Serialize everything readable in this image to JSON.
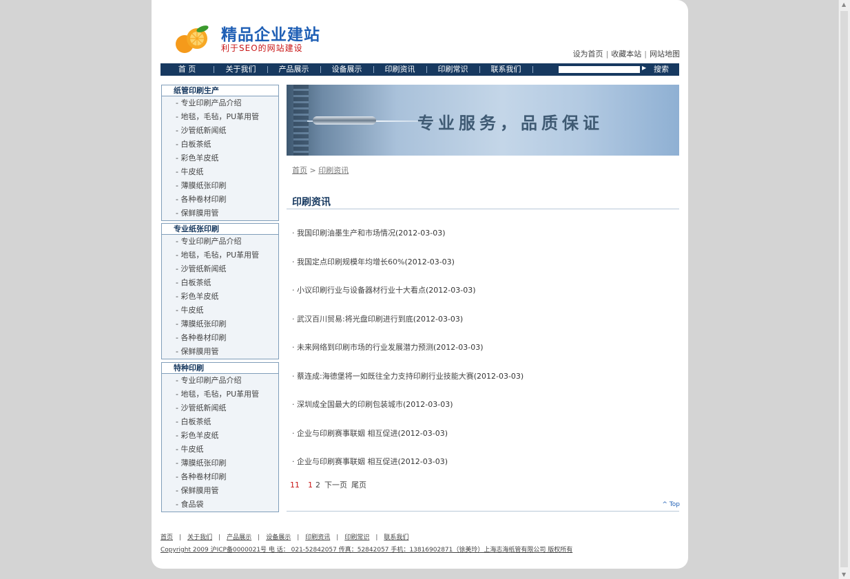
{
  "header": {
    "logo_name": "精品企业建站",
    "logo_slogan": "利于SEO的网站建设",
    "top_links": [
      "设为首页",
      "收藏本站",
      "网站地图"
    ]
  },
  "nav": {
    "items": [
      "首 页",
      "关于我们",
      "产品展示",
      "设备展示",
      "印刷资讯",
      "印刷常识",
      "联系我们"
    ],
    "search_button": "搜索",
    "search_value": ""
  },
  "sidebar": [
    {
      "title": "纸管印刷生产",
      "items": [
        "- 专业印刷产品介绍",
        "- 地毯，毛毡，PU革用管",
        "- 沙管纸新闻纸",
        "- 白板茶纸",
        "- 彩色羊皮纸",
        "- 牛皮纸",
        "- 薄膜纸张印刷",
        "- 各种卷材印刷",
        "- 保鲜膜用管"
      ]
    },
    {
      "title": "专业纸张印刷",
      "items": [
        "- 专业印刷产品介绍",
        "- 地毯，毛毡，PU革用管",
        "- 沙管纸新闻纸",
        "- 白板茶纸",
        "- 彩色羊皮纸",
        "- 牛皮纸",
        "- 薄膜纸张印刷",
        "- 各种卷材印刷",
        "- 保鲜膜用管"
      ]
    },
    {
      "title": "特种印刷",
      "items": [
        "- 专业印刷产品介绍",
        "- 地毯，毛毡，PU革用管",
        "- 沙管纸新闻纸",
        "- 白板茶纸",
        "- 彩色羊皮纸",
        "- 牛皮纸",
        "- 薄膜纸张印刷",
        "- 各种卷材印刷",
        "- 保鲜膜用管",
        "- 食品袋"
      ]
    }
  ],
  "banner": {
    "slogan": "专业服务，品质保证"
  },
  "breadcrumb": {
    "home": "首页",
    "sep": " > ",
    "current": "印刷资讯"
  },
  "section_title": "印刷资讯",
  "news": [
    {
      "title": "· 我国印刷油墨生产和市场情况",
      "date": "(2012-03-03)"
    },
    {
      "title": "· 我国定点印刷规模年均增长60%",
      "date": "(2012-03-03)"
    },
    {
      "title": "· 小议印刷行业与设备器材行业十大看点",
      "date": "(2012-03-03)"
    },
    {
      "title": "· 武汉百川贸易:将光盘印刷进行到底",
      "date": "(2012-03-03)"
    },
    {
      "title": "· 未来网络到印刷市场的行业发展潜力预测",
      "date": "(2012-03-03)"
    },
    {
      "title": "· 蔡连成:海德堡将一如既往全力支持印刷行业技能大赛",
      "date": "(2012-03-03)"
    },
    {
      "title": "· 深圳成全国最大的印刷包装城市",
      "date": "(2012-03-03)"
    },
    {
      "title": "· 企业与印刷赛事联姻 相互促进",
      "date": "(2012-03-03)"
    },
    {
      "title": "· 企业与印刷赛事联姻 相互促进",
      "date": "(2012-03-03)"
    }
  ],
  "pager": {
    "count": "11",
    "current": "1",
    "next_page_num": "2",
    "next": "下一页",
    "last": "尾页"
  },
  "to_top": "^ Top",
  "footer": {
    "links": [
      "首页",
      "关于我们",
      "产品展示",
      "设备展示",
      "印刷资讯",
      "印刷常识",
      "联系我们"
    ],
    "copyright": "Copyright 2009 沪ICP备0000021号 电 话： 021-52842057 传真：52842057 手机：13816902871（徐美玲）上海志海纸管有限公司 版权所有"
  }
}
